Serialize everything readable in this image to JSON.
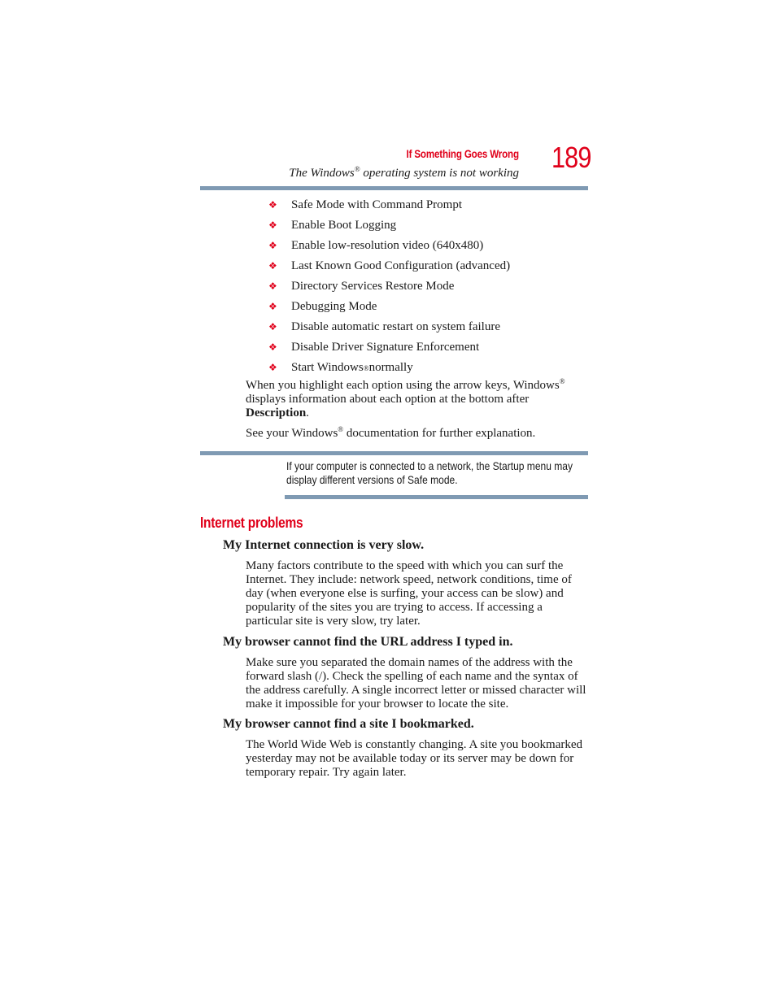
{
  "header": {
    "section": "If Something Goes Wrong",
    "subtitle_before": "The Windows",
    "subtitle_reg": "®",
    "subtitle_after": " operating system is not working",
    "page_number": "189"
  },
  "colors": {
    "accent": "#e0001a",
    "rule": "#7f9ab3",
    "text": "#1a1a1a"
  },
  "bullet_icon": "diamond-fleuron-icon",
  "startup_options": [
    {
      "label": "Safe Mode with Command Prompt"
    },
    {
      "label": "Enable Boot Logging"
    },
    {
      "label": "Enable low-resolution video (640x480)"
    },
    {
      "label": "Last Known Good Configuration (advanced)"
    },
    {
      "label": "Directory Services Restore Mode"
    },
    {
      "label": "Debugging Mode"
    },
    {
      "label": "Disable automatic restart on system failure"
    },
    {
      "label": "Disable Driver Signature Enforcement"
    },
    {
      "label": "Start Windows",
      "reg": "®",
      "label_after": " normally"
    }
  ],
  "highlight_paragraph": {
    "part1": "When you highlight each option using the arrow keys, Windows",
    "reg": "®",
    "part2": " displays information about each option at the bottom after ",
    "bold": "Description",
    "part3": "."
  },
  "see_paragraph": {
    "part1": "See your Windows",
    "reg": "®",
    "part2": " documentation for further explanation."
  },
  "note": {
    "text": "If your computer is connected to a network, the Startup menu may display different versions of Safe mode."
  },
  "internet_problems": {
    "title": "Internet problems",
    "items": [
      {
        "question": "My Internet connection is very slow.",
        "answer": "Many factors contribute to the speed with which you can surf the Internet. They include: network speed, network conditions, time of day (when everyone else is surfing, your access can be slow) and popularity of the sites you are trying to access. If accessing a particular site is very slow, try later."
      },
      {
        "question": "My browser cannot find the URL address I typed in.",
        "answer": "Make sure you separated the domain names of the address with the forward slash (/). Check the spelling of each name and the syntax of the address carefully. A single incorrect letter or missed character will make it impossible for your browser to locate the site."
      },
      {
        "question": "My browser cannot find a site I bookmarked.",
        "answer": "The World Wide Web is constantly changing. A site you bookmarked yesterday may not be available today or its server may be down for temporary repair. Try again later."
      }
    ]
  }
}
